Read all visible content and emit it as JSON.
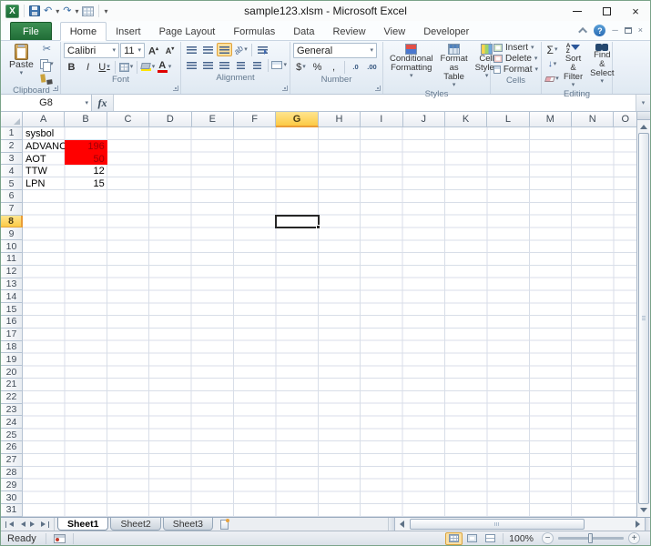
{
  "colors": {
    "file_tab_green": "#2E7D46",
    "red_cell_fill": "#FF0000",
    "red_cell_text": "#9C0006",
    "selected_header_amber": "#FCCA45",
    "selection_border": "#262626"
  },
  "titlebar": {
    "title": "sample123.xlsm - Microsoft Excel"
  },
  "qat": {
    "icons": [
      "excel-logo",
      "save",
      "undo",
      "redo",
      "table-grid",
      "customize-quick-access-dropdown"
    ]
  },
  "tabs": {
    "items": [
      {
        "label": "File",
        "type": "file"
      },
      {
        "label": "Home",
        "active": true
      },
      {
        "label": "Insert"
      },
      {
        "label": "Page Layout"
      },
      {
        "label": "Formulas"
      },
      {
        "label": "Data"
      },
      {
        "label": "Review"
      },
      {
        "label": "View"
      },
      {
        "label": "Developer"
      }
    ]
  },
  "ribbon": {
    "clipboard": {
      "label": "Clipboard",
      "paste": "Paste"
    },
    "font": {
      "label": "Font",
      "family": "Calibri",
      "size": "11"
    },
    "alignment": {
      "label": "Alignment"
    },
    "number": {
      "label": "Number",
      "format": "General"
    },
    "styles": {
      "label": "Styles",
      "conditional": "Conditional Formatting",
      "format_table": "Format as Table",
      "cell_styles": "Cell Styles"
    },
    "cells": {
      "label": "Cells",
      "insert": "Insert",
      "delete": "Delete",
      "format": "Format"
    },
    "editing": {
      "label": "Editing",
      "sort": "Sort & Filter",
      "find": "Find & Select"
    }
  },
  "formula_bar": {
    "name_box": "G8",
    "formula": ""
  },
  "grid": {
    "columns": [
      "A",
      "B",
      "C",
      "D",
      "E",
      "F",
      "G",
      "H",
      "I",
      "J",
      "K",
      "L",
      "M",
      "N",
      "O"
    ],
    "row_count": 31,
    "selected_column": "G",
    "selected_row": 8,
    "selection_cell": "G8",
    "cells": [
      {
        "col": "A",
        "row": 1,
        "text": "sysbol",
        "align": "left",
        "style": "plain"
      },
      {
        "col": "A",
        "row": 2,
        "text": "ADVANC",
        "align": "left",
        "style": "plain"
      },
      {
        "col": "B",
        "row": 2,
        "text": "196",
        "align": "right",
        "style": "red"
      },
      {
        "col": "A",
        "row": 3,
        "text": "AOT",
        "align": "left",
        "style": "plain"
      },
      {
        "col": "B",
        "row": 3,
        "text": "50",
        "align": "right",
        "style": "red"
      },
      {
        "col": "A",
        "row": 4,
        "text": "TTW",
        "align": "left",
        "style": "plain"
      },
      {
        "col": "B",
        "row": 4,
        "text": "12",
        "align": "right",
        "style": "plain"
      },
      {
        "col": "A",
        "row": 5,
        "text": "LPN",
        "align": "left",
        "style": "plain"
      },
      {
        "col": "B",
        "row": 5,
        "text": "15",
        "align": "right",
        "style": "plain"
      }
    ]
  },
  "sheet_tabs": {
    "tabs": [
      {
        "label": "Sheet1",
        "active": true
      },
      {
        "label": "Sheet2",
        "active": false
      },
      {
        "label": "Sheet3",
        "active": false
      }
    ]
  },
  "status_bar": {
    "ready": "Ready",
    "zoom_level": "100%"
  },
  "icons": {
    "dropdown": "▾",
    "undo": "↶",
    "redo": "↷",
    "cut": "✂",
    "sum": "Σ",
    "fill_down": "↓",
    "fx": "fx",
    "bold": "B",
    "italic": "I",
    "underline": "U",
    "grow_font": "A",
    "shrink_font": "A",
    "font_color": "A",
    "dollar": "$",
    "percent": "%",
    "comma": ",",
    "increase_decimal": ".0",
    "decrease_decimal": ".00",
    "orientation": "ab",
    "help": "?",
    "close": "×",
    "sort_a": "A",
    "sort_z": "Z",
    "expand_formula_bar": "▾"
  }
}
